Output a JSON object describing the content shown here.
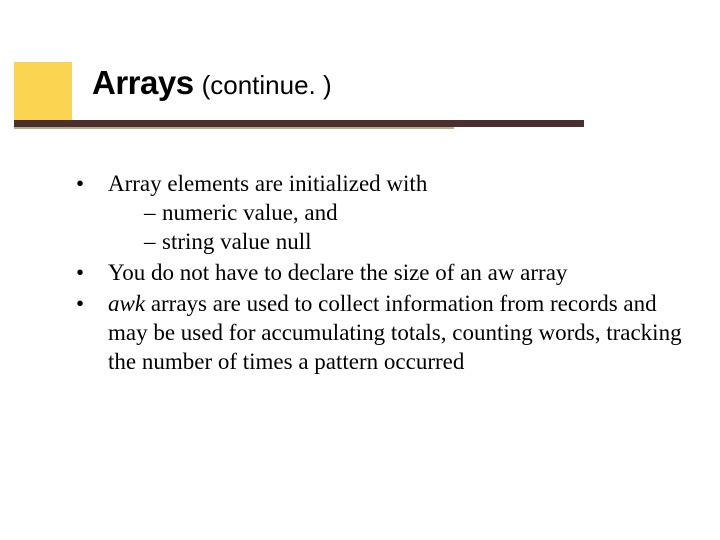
{
  "title": {
    "main": "Arrays",
    "suffix": "(continue. )"
  },
  "bullets": {
    "b1": {
      "text": "Array elements are initialized with",
      "sub1": "numeric value, and",
      "sub2": "string value null"
    },
    "b2": {
      "text": "You do not have to declare the size of an aw array"
    },
    "b3": {
      "italic": "awk",
      "rest": " arrays are used to collect information from records and may be used for accumulating totals, counting words, tracking the number of times a pattern occurred"
    }
  }
}
